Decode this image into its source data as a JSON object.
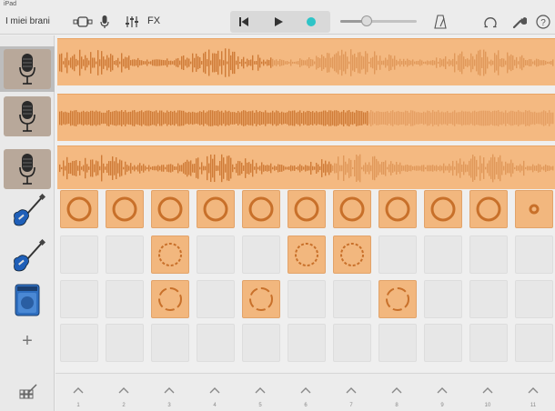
{
  "status": {
    "device": "iPad"
  },
  "toolbar": {
    "my_songs_label": "I miei brani",
    "fx_label": "FX",
    "tempo_slider_level": 0.35
  },
  "colors": {
    "region": "#f4b981",
    "wave": "#c8702a",
    "cell_on": "#f2b77e",
    "cell_off": "#e7e7e7",
    "play_indicator": "#2ec4c7"
  },
  "tracks": [
    {
      "instrument": "microphone-icon",
      "type": "audio",
      "selected": true
    },
    {
      "instrument": "microphone-icon",
      "type": "audio",
      "selected": false
    },
    {
      "instrument": "microphone-icon",
      "type": "audio",
      "selected": false
    },
    {
      "instrument": "guitar-icon",
      "type": "cells",
      "cells": [
        1,
        1,
        1,
        1,
        1,
        1,
        1,
        1,
        1,
        1,
        1
      ]
    },
    {
      "instrument": "guitar-icon",
      "type": "cells",
      "cells": [
        0,
        0,
        1,
        0,
        0,
        1,
        1,
        0,
        0,
        0,
        0
      ]
    },
    {
      "instrument": "amp-icon",
      "type": "cells",
      "cells": [
        0,
        0,
        1,
        0,
        1,
        0,
        0,
        1,
        0,
        0,
        0
      ]
    },
    {
      "instrument": "empty",
      "type": "cells",
      "cells": [
        0,
        0,
        0,
        0,
        0,
        0,
        0,
        0,
        0,
        0,
        0
      ]
    }
  ],
  "columns": [
    "1",
    "2",
    "3",
    "4",
    "5",
    "6",
    "7",
    "8",
    "9",
    "10",
    "11"
  ]
}
